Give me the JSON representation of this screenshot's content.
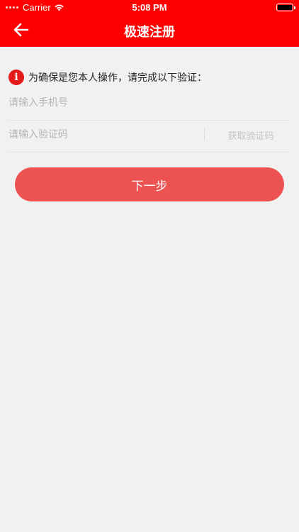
{
  "status_bar": {
    "carrier": "Carrier",
    "time": "5:08 PM",
    "icons": [
      "signal-dots-icon",
      "wifi-icon",
      "battery-icon"
    ]
  },
  "nav": {
    "title": "极速注册",
    "back_icon": "arrow-left-icon"
  },
  "notice": {
    "icon": "info-icon",
    "icon_glyph": "i",
    "text": "为确保是您本人操作，请完成以下验证："
  },
  "form": {
    "phone_placeholder": "请输入手机号",
    "phone_value": "",
    "code_placeholder": "请输入验证码",
    "code_value": "",
    "get_code_label": "获取验证码"
  },
  "next_button": {
    "label": "下一步"
  },
  "colors": {
    "brand_red": "#ff0000",
    "button_red": "#ee5353",
    "background": "#f2f1f2"
  }
}
